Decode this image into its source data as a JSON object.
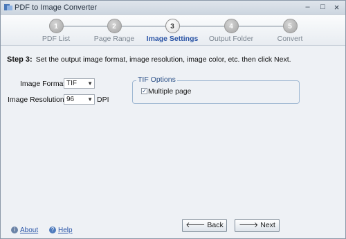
{
  "window": {
    "title": "PDF to Image Converter",
    "minimize": "–",
    "maximize": "□",
    "close": "×"
  },
  "steps": [
    {
      "number": "1",
      "label": "PDF List"
    },
    {
      "number": "2",
      "label": "Page Range"
    },
    {
      "number": "3",
      "label": "Image Settings"
    },
    {
      "number": "4",
      "label": "Output Folder"
    },
    {
      "number": "5",
      "label": "Convert"
    }
  ],
  "active_step": 3,
  "instruction": {
    "prefix": "Step 3:",
    "text": "Set the output image format, image resolution, image color, etc. then click Next."
  },
  "form": {
    "format_label": "Image Format:",
    "format_value": "TIF",
    "resolution_label": "Image Resolution:",
    "resolution_value": "96",
    "resolution_unit": "DPI"
  },
  "tif_options": {
    "title": "TIF Options",
    "multiple_page_label": "Multiple page",
    "multiple_page_checked": true
  },
  "footer": {
    "about": "About",
    "help": "Help",
    "back": "Back",
    "next": "Next"
  },
  "icons": {
    "dropdown": "chevron-down-icon",
    "back": "arrow-left-icon",
    "next": "arrow-right-icon"
  }
}
